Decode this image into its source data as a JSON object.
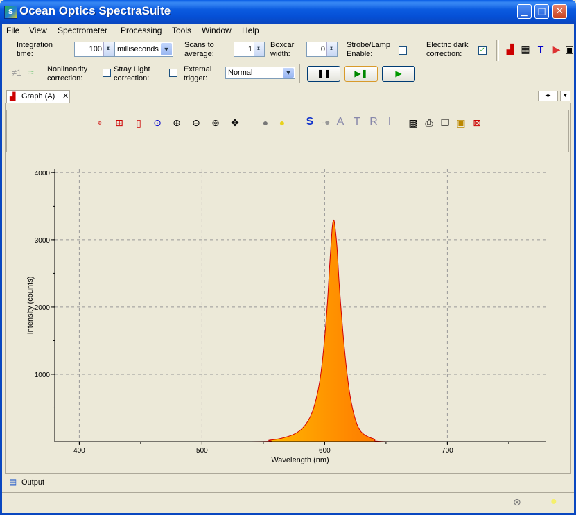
{
  "window": {
    "title": "Ocean Optics SpectraSuite",
    "icon_text": "S"
  },
  "menu": [
    "File",
    "View",
    "Spectrometer",
    "Processing",
    "Tools",
    "Window",
    "Help"
  ],
  "toolbar": {
    "integration_label": "Integration time:",
    "integration_value": "100",
    "integration_unit": "milliseconds",
    "scans_label": "Scans to average:",
    "scans_value": "1",
    "boxcar_label": "Boxcar width:",
    "boxcar_value": "0",
    "strobe_label": "Strobe/Lamp Enable:",
    "electric_dark_label": "Electric dark correction:",
    "nonlinearity_label": "Nonlinearity correction:",
    "stray_light_label": "Stray Light correction:",
    "external_trigger_label": "External trigger:",
    "trigger_mode": "Normal",
    "strobe_checked": false,
    "electric_dark_checked": true,
    "stray_light_checked": false,
    "external_trigger_checked": false
  },
  "tab": {
    "label": "Graph (A)"
  },
  "graph_toolbar": {
    "letters": [
      "S",
      "A",
      "T",
      "R",
      "I"
    ]
  },
  "output": {
    "label": "Output"
  },
  "chart_data": {
    "type": "area",
    "xlabel": "Wavelength (nm)",
    "ylabel": "Intensity (counts)",
    "xlim": [
      380,
      780
    ],
    "ylim": [
      0,
      4050
    ],
    "xticks": [
      400,
      500,
      600,
      700
    ],
    "yticks": [
      1000,
      2000,
      3000,
      4000
    ],
    "grid": true,
    "x": [
      380,
      540,
      555,
      565,
      575,
      582,
      588,
      592,
      596,
      599,
      602,
      604,
      606,
      607,
      608,
      610,
      612,
      615,
      618,
      621,
      625,
      630,
      640,
      655,
      780
    ],
    "y": [
      0,
      0,
      20,
      50,
      110,
      200,
      360,
      560,
      900,
      1350,
      2000,
      2600,
      3150,
      3280,
      3250,
      2900,
      2300,
      1600,
      1050,
      650,
      330,
      140,
      40,
      0,
      0
    ]
  }
}
